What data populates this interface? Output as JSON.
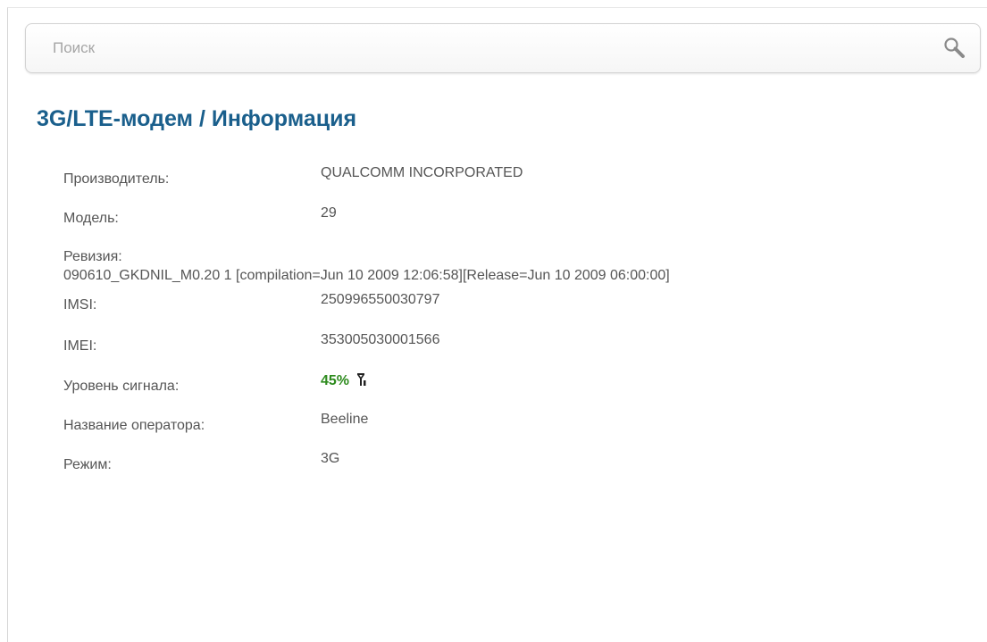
{
  "search": {
    "placeholder": "Поиск"
  },
  "breadcrumb": {
    "section": "3G/LTE-модем /",
    "page": "Информация"
  },
  "info": {
    "manufacturer": {
      "label": "Производитель:",
      "value": "QUALCOMM INCORPORATED"
    },
    "model": {
      "label": "Модель:",
      "value": "29"
    },
    "revision": {
      "label": "Ревизия:",
      "value": "090610_GKDNIL_M0.20 1 [compilation=Jun 10 2009 12:06:58][Release=Jun 10 2009 06:00:00]"
    },
    "imsi": {
      "label": "IMSI:",
      "value": "250996550030797"
    },
    "imei": {
      "label": "IMEI:",
      "value": "353005030001566"
    },
    "signal": {
      "label": "Уровень сигнала:",
      "value": "45%",
      "icon": "signal-antenna-icon",
      "color": "#2e8b1e"
    },
    "operator": {
      "label": "Название оператора:",
      "value": "Beeline"
    },
    "mode": {
      "label": "Режим:",
      "value": "3G"
    }
  },
  "colors": {
    "title": "#1a5f8c",
    "text": "#555555",
    "signal": "#2e8b1e"
  }
}
